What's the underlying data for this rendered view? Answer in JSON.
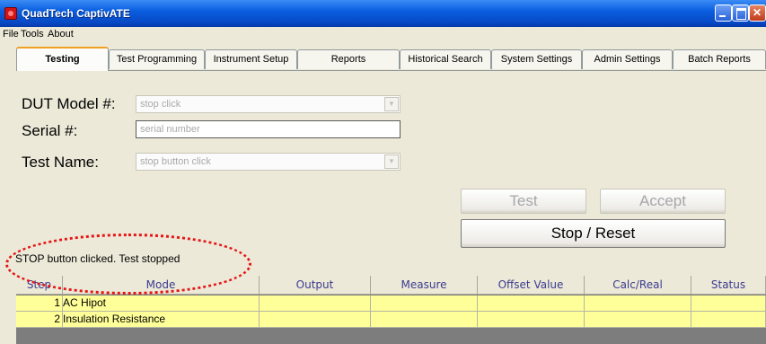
{
  "window": {
    "title": "QuadTech CaptivATE"
  },
  "menu": [
    "File",
    "Tools",
    "About"
  ],
  "tabs": [
    {
      "label": "Testing",
      "active": true
    },
    {
      "label": "Test Programming"
    },
    {
      "label": "Instrument Setup"
    },
    {
      "label": "Reports"
    },
    {
      "label": "Historical Search"
    },
    {
      "label": "System Settings"
    },
    {
      "label": "Admin Settings"
    },
    {
      "label": "Batch Reports"
    }
  ],
  "form": {
    "dut_label": "DUT Model #:",
    "dut_value": "stop click",
    "serial_label": "Serial #:",
    "serial_placeholder": "serial number",
    "testname_label": "Test Name:",
    "testname_value": "stop button click"
  },
  "buttons": {
    "test": "Test",
    "accept": "Accept",
    "stop_reset": "Stop / Reset"
  },
  "status": "STOP button clicked. Test stopped",
  "grid": {
    "columns": [
      "Step",
      "Mode",
      "Output",
      "Measure",
      "Offset Value",
      "Calc/Real",
      "Status"
    ],
    "rows": [
      {
        "step": "1",
        "mode": "AC Hipot",
        "output": "",
        "measure": "",
        "offset": "",
        "calc": "",
        "status": ""
      },
      {
        "step": "2",
        "mode": "Insulation Resistance",
        "output": "",
        "measure": "",
        "offset": "",
        "calc": "",
        "status": ""
      }
    ]
  },
  "colors": {
    "annotation": "#e51515",
    "row_highlight": "#ffff99",
    "titlebar": "#0a5fe0"
  }
}
